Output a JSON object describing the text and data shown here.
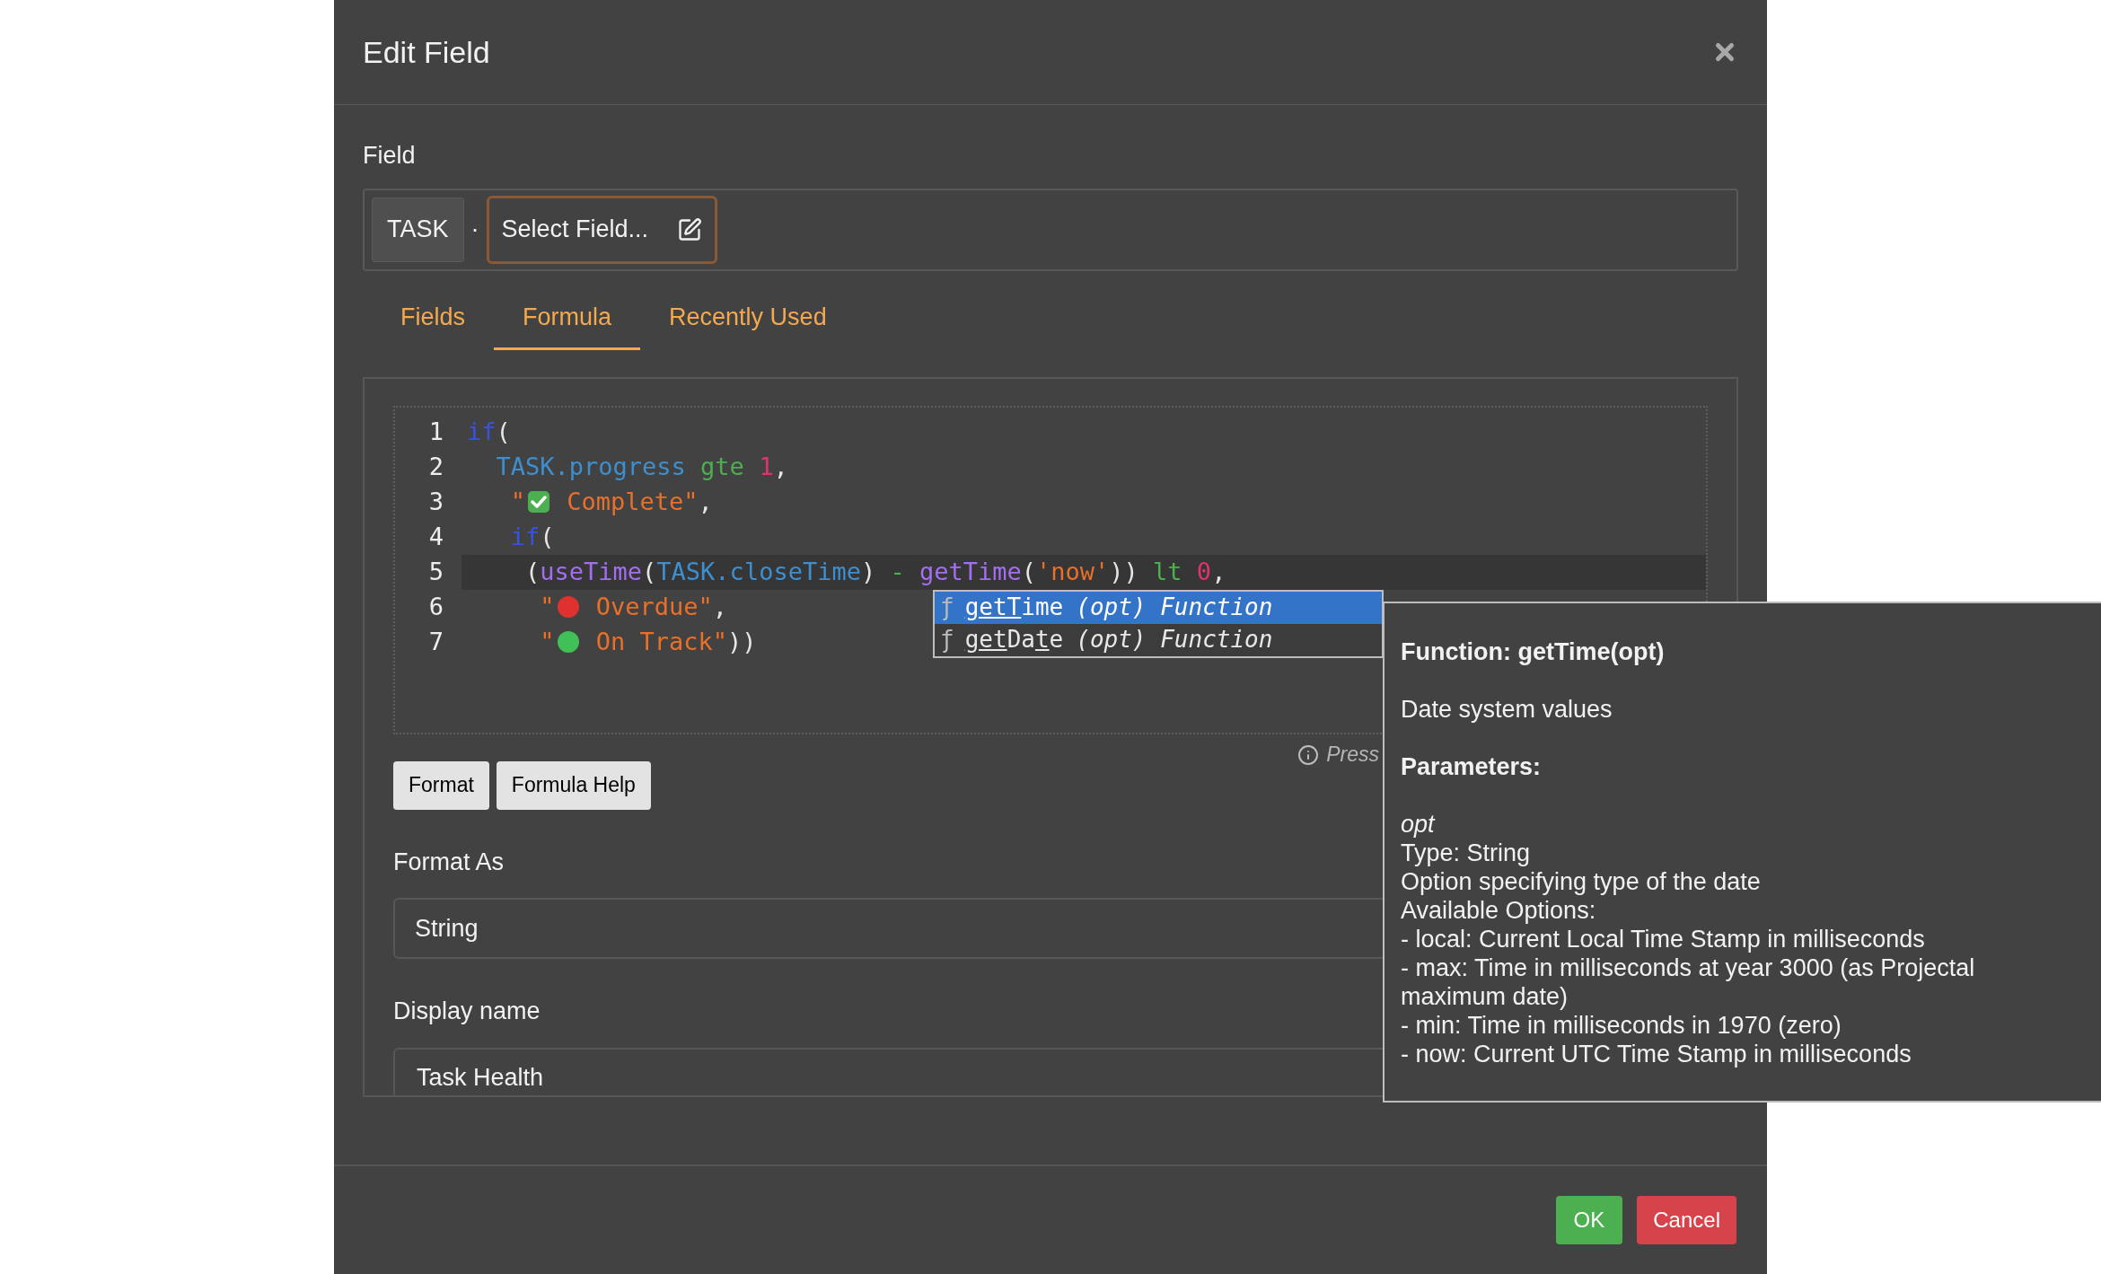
{
  "dialog": {
    "title": "Edit Field"
  },
  "field": {
    "label": "Field",
    "entity": "TASK",
    "separator": "·",
    "select_placeholder": "Select Field..."
  },
  "tabs": [
    {
      "label": "Fields",
      "selected": false
    },
    {
      "label": "Formula",
      "selected": true
    },
    {
      "label": "Recently Used",
      "selected": false
    }
  ],
  "editor": {
    "lines": [
      {
        "number": "1",
        "current": false,
        "tokens": [
          {
            "kind": "keyword",
            "text": "if"
          },
          {
            "kind": "punct",
            "text": "("
          }
        ]
      },
      {
        "number": "2",
        "current": false,
        "tokens": [
          {
            "kind": "field",
            "text": "  TASK.progress"
          },
          {
            "kind": "operator",
            "text": " gte"
          },
          {
            "kind": "number",
            "text": " 1"
          },
          {
            "kind": "punct",
            "text": ","
          }
        ]
      },
      {
        "number": "3",
        "current": false,
        "tokens": [
          {
            "kind": "string",
            "text": "   \""
          },
          {
            "kind": "check"
          },
          {
            "kind": "string",
            "text": " Complete\""
          },
          {
            "kind": "punct",
            "text": ","
          }
        ]
      },
      {
        "number": "4",
        "current": false,
        "tokens": [
          {
            "kind": "keyword",
            "text": "   if"
          },
          {
            "kind": "punct",
            "text": "("
          }
        ]
      },
      {
        "number": "5",
        "current": true,
        "tokens": [
          {
            "kind": "punct",
            "text": "    ("
          },
          {
            "kind": "function",
            "text": "useTime"
          },
          {
            "kind": "punct",
            "text": "("
          },
          {
            "kind": "field",
            "text": "TASK.closeTime"
          },
          {
            "kind": "punct",
            "text": ")"
          },
          {
            "kind": "operator",
            "text": " - "
          },
          {
            "kind": "function",
            "text": "getTime"
          },
          {
            "kind": "punct",
            "text": "("
          },
          {
            "kind": "string",
            "text": "'now'"
          },
          {
            "kind": "punct",
            "text": "))"
          },
          {
            "kind": "operator",
            "text": " lt"
          },
          {
            "kind": "number",
            "text": " 0"
          },
          {
            "kind": "punct",
            "text": ","
          }
        ]
      },
      {
        "number": "6",
        "current": false,
        "tokens": [
          {
            "kind": "string",
            "text": "     \""
          },
          {
            "kind": "dot",
            "color": "#e03131"
          },
          {
            "kind": "string",
            "text": " Overdue\""
          },
          {
            "kind": "punct",
            "text": ","
          }
        ]
      },
      {
        "number": "7",
        "current": false,
        "tokens": [
          {
            "kind": "string",
            "text": "     \""
          },
          {
            "kind": "dot",
            "color": "#40c057"
          },
          {
            "kind": "string",
            "text": " On Track\""
          },
          {
            "kind": "punct",
            "text": "))"
          }
        ]
      }
    ]
  },
  "autocomplete": [
    {
      "symbol": "ƒ",
      "parts": [
        {
          "text": "getT",
          "matched": true
        },
        {
          "text": "ime",
          "matched": false
        }
      ],
      "args": "(opt)",
      "type": "Function",
      "selected": true
    },
    {
      "symbol": "ƒ",
      "parts": [
        {
          "text": "get",
          "matched": true
        },
        {
          "text": "Da",
          "matched": false
        },
        {
          "text": "t",
          "matched": true
        },
        {
          "text": "e",
          "matched": false
        }
      ],
      "args": "(opt)",
      "type": "Function",
      "selected": false
    }
  ],
  "hint": "Press",
  "buttons": [
    "Format",
    "Formula Help"
  ],
  "format_as": {
    "label": "Format As",
    "value": "String"
  },
  "display_name": {
    "label": "Display name",
    "value": "Task Health"
  },
  "tooltip": {
    "title": "Function: getTime(opt)",
    "description": "Date system values",
    "params_heading": "Parameters:",
    "param_name": "opt",
    "lines": [
      "Type: String",
      "Option specifying type of the date",
      "Available Options:",
      "- local: Current Local Time Stamp in milliseconds",
      "- max: Time in milliseconds at year 3000 (as Projectal maximum date)",
      "- min: Time in milliseconds in 1970 (zero)",
      "- now: Current UTC Time Stamp in milliseconds"
    ]
  },
  "footer": {
    "ok": "OK",
    "cancel": "Cancel"
  }
}
